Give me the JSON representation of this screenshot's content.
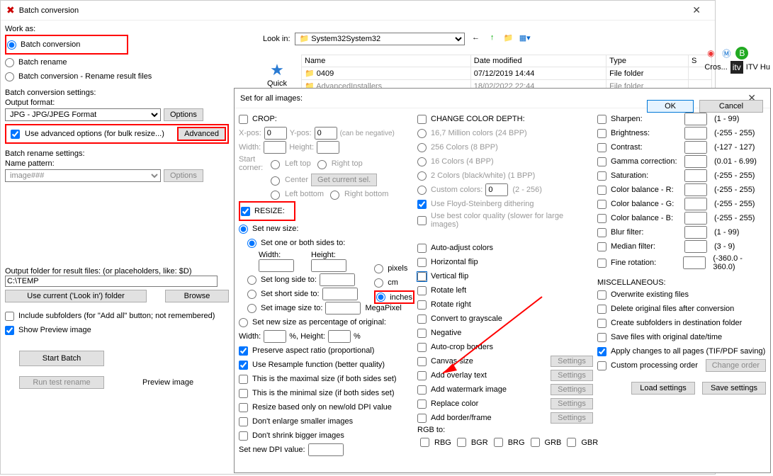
{
  "main": {
    "title": "Batch conversion",
    "work_as": "Work as:",
    "r1": "Batch conversion",
    "r2": "Batch rename",
    "r3": "Batch conversion - Rename result files",
    "bc_settings": "Batch conversion settings:",
    "out_fmt": "Output format:",
    "fmt_val": "JPG - JPG/JPEG Format",
    "options": "Options",
    "use_adv": "Use advanced options (for bulk resize...)",
    "advanced": "Advanced",
    "br_settings": "Batch rename settings:",
    "name_pat": "Name pattern:",
    "pattern": "image###",
    "out_folder": "Output folder for result files: (or placeholders, like: $D)",
    "out_path": "C:\\TEMP",
    "use_current": "Use current ('Look in') folder",
    "browse": "Browse",
    "incl_sub": "Include subfolders (for \"Add all\" button; not remembered)",
    "show_prev": "Show Preview image",
    "start": "Start Batch",
    "run_test": "Run test rename",
    "prev_img": "Preview image"
  },
  "lookin": {
    "label": "Look in:",
    "val": "System32"
  },
  "files": {
    "h1": "Name",
    "h2": "Date modified",
    "h3": "Type",
    "h4": "S",
    "r1c1": "0409",
    "r1c2": "07/12/2019 14:44",
    "r1c3": "File folder",
    "r2c1": "AdvancedInstallers",
    "r2c2": "18/02/2022 22:44",
    "r2c3": "File folder",
    "quick": "Quick access"
  },
  "adv": {
    "title": "Set for all images:",
    "crop": "CROP:",
    "xpos": "X-pos:",
    "ypos": "Y-pos:",
    "zero": "0",
    "width": "Width:",
    "height": "Height:",
    "can_neg": "(can be negative)",
    "start_corner": "Start corner:",
    "lt": "Left top",
    "rt": "Right top",
    "ctr": "Center",
    "get_cur": "Get current sel.",
    "lb": "Left bottom",
    "rb": "Right bottom",
    "resize": "RESIZE:",
    "set_new": "Set new size:",
    "set_one": "Set one or both sides to:",
    "set_long": "Set long side to:",
    "set_short": "Set short side to:",
    "set_img": "Set image size to:",
    "set_pct": "Set new size as percentage of original:",
    "px": "pixels",
    "cm": "cm",
    "inch": "inches",
    "mp": "MegaPixel",
    "pct_w": "Width:",
    "pct_h": "%, Height:",
    "pct": "%",
    "preserve": "Preserve aspect ratio (proportional)",
    "resample": "Use Resample function (better quality)",
    "maxsize": "This is the maximal size (if both sides set)",
    "minsize": "This is the minimal size (if both sides set)",
    "dpi_only": "Resize based only on new/old DPI value",
    "no_enlarge": "Don't enlarge smaller images",
    "no_shrink": "Don't shrink bigger images",
    "new_dpi": "Set new DPI value:",
    "ccd": "CHANGE COLOR DEPTH:",
    "c1": "16,7 Million colors (24 BPP)",
    "c2": "256 Colors (8 BPP)",
    "c3": "16 Colors (4 BPP)",
    "c4": "2 Colors (black/white) (1 BPP)",
    "c5": "Custom colors:",
    "c5r": "(2 - 256)",
    "fs": "Use Floyd-Steinberg dithering",
    "bestq": "Use best color quality (slower for large images)",
    "auto_adj": "Auto-adjust colors",
    "hflip": "Horizontal flip",
    "vflip": "Vertical flip",
    "rl": "Rotate left",
    "rr": "Rotate right",
    "gray": "Convert to grayscale",
    "neg": "Negative",
    "acrop": "Auto-crop borders",
    "canvas": "Canvas size",
    "overlay": "Add overlay text",
    "wmark": "Add watermark image",
    "repl": "Replace color",
    "bframe": "Add border/frame",
    "settings": "Settings",
    "rgbto": "RGB to:",
    "rbg": "RBG",
    "bgr": "BGR",
    "brg": "BRG",
    "grb": "GRB",
    "gbr": "GBR",
    "sharpen": "Sharpen:",
    "r_sharpen": "(1  -  99)",
    "bright": "Brightness:",
    "r_255": "(-255  -  255)",
    "contrast": "Contrast:",
    "r_127": "(-127  -  127)",
    "gamma": "Gamma correction:",
    "r_gamma": "(0.01  -  6.99)",
    "sat": "Saturation:",
    "cbr": "Color balance - R:",
    "cbg": "Color balance - G:",
    "cbb": "Color balance - B:",
    "blur": "Blur filter:",
    "r_blur": "(1  -  99)",
    "median": "Median filter:",
    "r_med": "(3  -  9)",
    "finerot": "Fine rotation:",
    "r_rot": "(-360.0  -  360.0)",
    "misc": "MISCELLANEOUS:",
    "over": "Overwrite existing files",
    "delorig": "Delete original files after conversion",
    "createsub": "Create subfolders in destination folder",
    "savedate": "Save files with original date/time",
    "applyall": "Apply changes to all pages (TIF/PDF saving)",
    "custord": "Custom processing order",
    "chord": "Change order",
    "load": "Load settings",
    "save": "Save settings",
    "ok": "OK",
    "cancel": "Cancel"
  },
  "tb": {
    "cros": "Cros...",
    "itv": "ITV Hu"
  }
}
